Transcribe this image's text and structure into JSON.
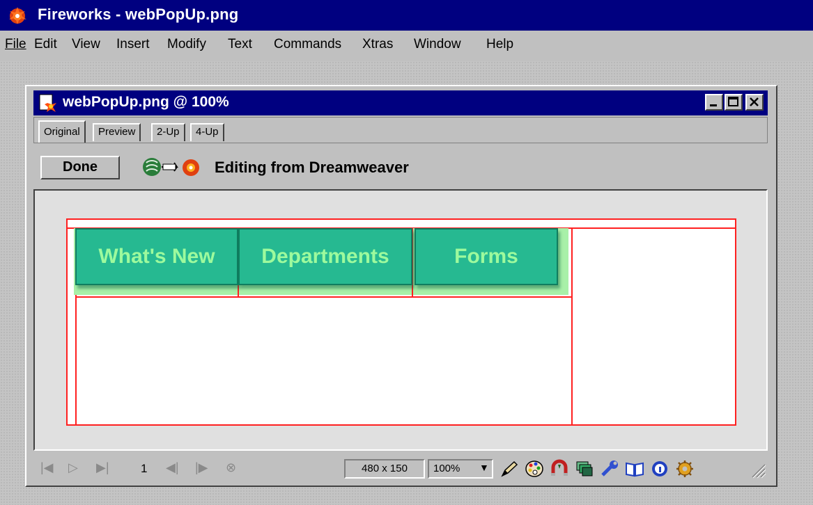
{
  "app": {
    "title": "Fireworks - webPopUp.png"
  },
  "menu": [
    "File",
    "Edit",
    "View",
    "Insert",
    "Modify",
    "Text",
    "Commands",
    "Xtras",
    "Window",
    "Help"
  ],
  "document": {
    "title": "webPopUp.png @  100%",
    "tabs": [
      "Original",
      "Preview",
      "2-Up",
      "4-Up"
    ],
    "active_tab": "Original",
    "done_label": "Done",
    "editing_label": "Editing from Dreamweaver"
  },
  "canvas": {
    "nav_buttons": [
      "What's New",
      "Departments",
      "Forms"
    ],
    "button_color": "#26b991",
    "button_text_color": "#9dfa9d",
    "slice_color": "#ff2020"
  },
  "status": {
    "vcr_controls": [
      "first-frame-icon",
      "play-icon",
      "last-frame-icon",
      "prev-frame-icon",
      "next-frame-icon",
      "stop-icon"
    ],
    "frame": "1",
    "dimensions": "480 x 150",
    "zoom": "100%",
    "tools": [
      "pencil-icon",
      "color-palette-icon",
      "magnet-icon",
      "layers-icon",
      "wrench-icon",
      "book-icon",
      "info-icon",
      "gear-icon"
    ]
  }
}
